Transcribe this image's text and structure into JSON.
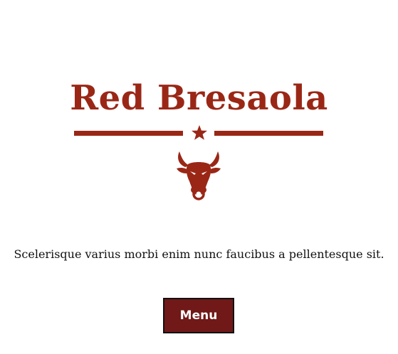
{
  "brand": {
    "title": "Red Bresaola",
    "color": "#9a2716"
  },
  "divider": {
    "ornament_icon": "star-icon"
  },
  "logo": {
    "icon": "bull-head-icon"
  },
  "tagline": "Scelerisque varius morbi enim nunc faucibus a pellentesque sit.",
  "menu_button": {
    "label": "Menu",
    "background": "#701918"
  }
}
